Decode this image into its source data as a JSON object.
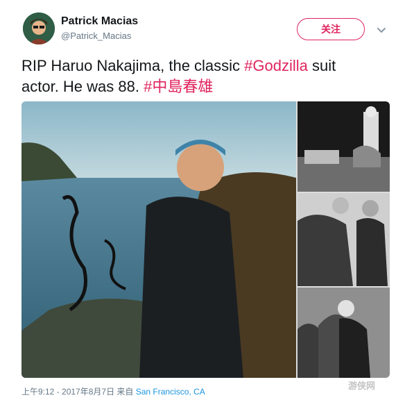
{
  "user": {
    "display_name": "Patrick Macias",
    "handle": "@Patrick_Macias"
  },
  "follow_button": {
    "label": "关注"
  },
  "tweet": {
    "text_line1_prefix": "RIP Haruo Nakajima, the classic ",
    "hashtag1": "#Godzilla",
    "text_line1_suffix": " suit",
    "text_line2": "actor. He was 88. ",
    "hashtag2": "#中島春雄"
  },
  "meta": {
    "timestamp": "上午9:12 - 2017年8月7日 来自 ",
    "location": "San Francisco, CA"
  },
  "watermark": {
    "text": "游侠网"
  },
  "colors": {
    "accent": "#e0245e",
    "link": "#1b95e0",
    "secondary": "#657786"
  },
  "icons": {
    "caret": "chevron-down-icon"
  }
}
